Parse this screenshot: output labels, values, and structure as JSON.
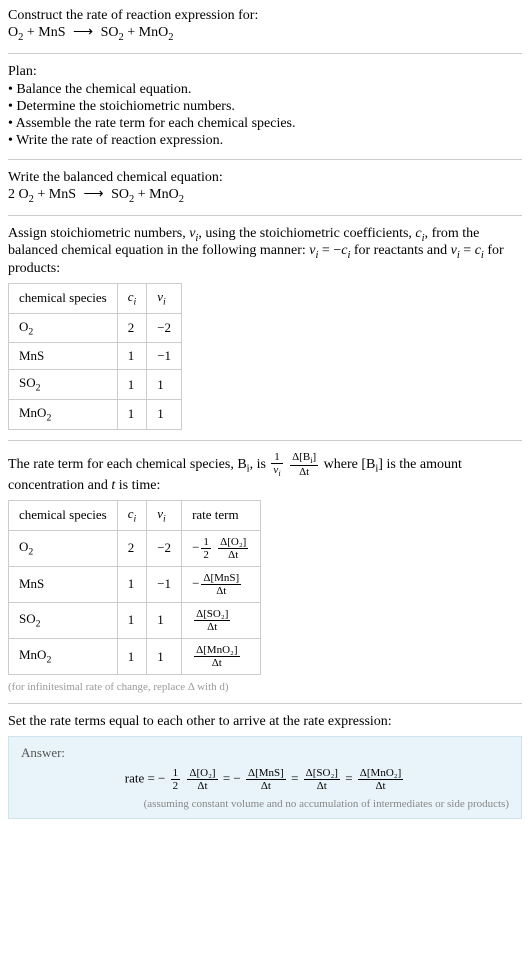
{
  "header": {
    "prompt": "Construct the rate of reaction expression for:",
    "equation_lhs1": "O",
    "equation_lhs1_sub": "2",
    "equation_lhs2": "MnS",
    "equation_rhs1": "SO",
    "equation_rhs1_sub": "2",
    "equation_rhs2": "MnO",
    "equation_rhs2_sub": "2"
  },
  "plan": {
    "title": "Plan:",
    "b1": "• Balance the chemical equation.",
    "b2": "• Determine the stoichiometric numbers.",
    "b3": "• Assemble the rate term for each chemical species.",
    "b4": "• Write the rate of reaction expression."
  },
  "balanced": {
    "title": "Write the balanced chemical equation:",
    "coef1": "2 ",
    "sp1": "O",
    "sp1_sub": "2",
    "sp2": "MnS",
    "sp3": "SO",
    "sp3_sub": "2",
    "sp4": "MnO",
    "sp4_sub": "2"
  },
  "stoich": {
    "intro_a": "Assign stoichiometric numbers, ",
    "nu_i": "ν",
    "nu_i_sub": "i",
    "intro_b": ", using the stoichiometric coefficients, ",
    "c_i": "c",
    "c_i_sub": "i",
    "intro_c": ", from the balanced chemical equation in the following manner: ",
    "rel1_l": "ν",
    "rel1_lsub": "i",
    "rel1_eq": " = −",
    "rel1_r": "c",
    "rel1_rsub": "i",
    "intro_d": " for reactants and ",
    "rel2_l": "ν",
    "rel2_lsub": "i",
    "rel2_eq": " = ",
    "rel2_r": "c",
    "rel2_rsub": "i",
    "intro_e": " for products:",
    "h1": "chemical species",
    "h2": "cᵢ",
    "h3": "νᵢ",
    "r1": {
      "sp": "O",
      "sub": "2",
      "c": "2",
      "nu": "−2"
    },
    "r2": {
      "sp": "MnS",
      "sub": "",
      "c": "1",
      "nu": "−1"
    },
    "r3": {
      "sp": "SO",
      "sub": "2",
      "c": "1",
      "nu": "1"
    },
    "r4": {
      "sp": "MnO",
      "sub": "2",
      "c": "1",
      "nu": "1"
    }
  },
  "rateterm": {
    "intro_a": "The rate term for each chemical species, B",
    "intro_a_sub": "i",
    "intro_b": ", is ",
    "frac1_num": "1",
    "frac1_den_a": "ν",
    "frac1_den_sub": "i",
    "frac2_num_a": "Δ[B",
    "frac2_num_sub": "i",
    "frac2_num_b": "]",
    "frac2_den": "Δt",
    "intro_c": " where [B",
    "intro_c_sub": "i",
    "intro_d": "] is the amount concentration and ",
    "t_ital": "t",
    "intro_e": " is time:",
    "h1": "chemical species",
    "h2": "cᵢ",
    "h3": "νᵢ",
    "h4": "rate term",
    "r1": {
      "sp": "O",
      "sub": "2",
      "c": "2",
      "nu": "−2",
      "neg": "−",
      "coef_num": "1",
      "coef_den": "2",
      "dnum": "Δ[O₂]",
      "dden": "Δt"
    },
    "r2": {
      "sp": "MnS",
      "sub": "",
      "c": "1",
      "nu": "−1",
      "neg": "−",
      "coef_num": "",
      "coef_den": "",
      "dnum": "Δ[MnS]",
      "dden": "Δt"
    },
    "r3": {
      "sp": "SO",
      "sub": "2",
      "c": "1",
      "nu": "1",
      "neg": "",
      "coef_num": "",
      "coef_den": "",
      "dnum": "Δ[SO₂]",
      "dden": "Δt"
    },
    "r4": {
      "sp": "MnO",
      "sub": "2",
      "c": "1",
      "nu": "1",
      "neg": "",
      "coef_num": "",
      "coef_den": "",
      "dnum": "Δ[MnO₂]",
      "dden": "Δt"
    },
    "footnote": "(for infinitesimal rate of change, replace Δ with d)"
  },
  "final": {
    "title": "Set the rate terms equal to each other to arrive at the rate expression:",
    "answer_label": "Answer:",
    "rate_word": "rate = −",
    "f1_num": "1",
    "f1_den": "2",
    "t1_num": "Δ[O₂]",
    "t1_den": "Δt",
    "eq1": " = −",
    "t2_num": "Δ[MnS]",
    "t2_den": "Δt",
    "eq2": " = ",
    "t3_num": "Δ[SO₂]",
    "t3_den": "Δt",
    "eq3": " = ",
    "t4_num": "Δ[MnO₂]",
    "t4_den": "Δt",
    "note": "(assuming constant volume and no accumulation of intermediates or side products)"
  }
}
